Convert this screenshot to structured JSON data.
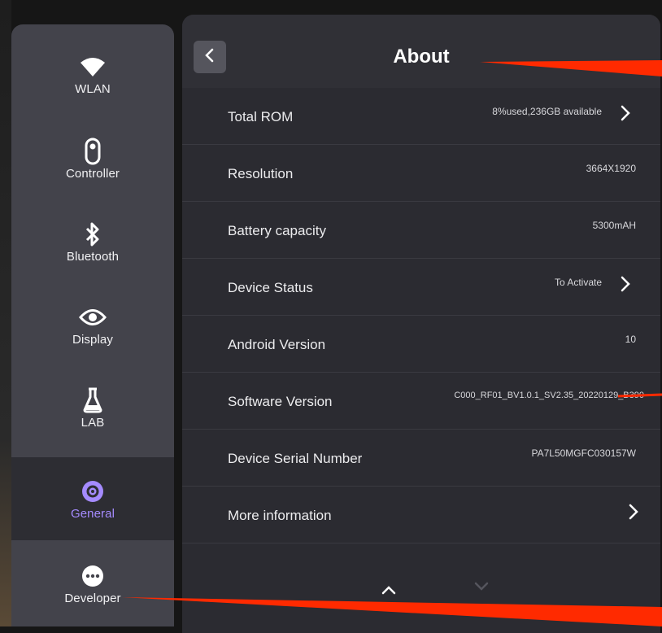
{
  "sidebar": {
    "items": [
      {
        "label": "WLAN",
        "icon": "wifi-icon",
        "active": false
      },
      {
        "label": "Controller",
        "icon": "controller-icon",
        "active": false
      },
      {
        "label": "Bluetooth",
        "icon": "bluetooth-icon",
        "active": false
      },
      {
        "label": "Display",
        "icon": "eye-icon",
        "active": false
      },
      {
        "label": "LAB",
        "icon": "flask-icon",
        "active": false
      },
      {
        "label": "General",
        "icon": "gear-icon",
        "active": true
      },
      {
        "label": "Developer",
        "icon": "more-dots-icon",
        "active": false
      }
    ]
  },
  "header": {
    "title": "About",
    "back_icon": "chevron-left-icon"
  },
  "rows": [
    {
      "label": "Total ROM",
      "value": "8%used,236GB available",
      "chevron": true
    },
    {
      "label": "Resolution",
      "value": "3664X1920",
      "chevron": false
    },
    {
      "label": "Battery capacity",
      "value": "5300mAH",
      "chevron": false
    },
    {
      "label": "Device Status",
      "value": "To Activate",
      "chevron": true
    },
    {
      "label": "Android Version",
      "value": "10",
      "chevron": false
    },
    {
      "label": "Software Version",
      "value": "C000_RF01_BV1.0.1_SV2.35_20220129_B390",
      "chevron": false
    },
    {
      "label": "Device Serial Number",
      "value": "PA7L50MGFC030157W",
      "chevron": false
    },
    {
      "label": "More information",
      "value": "",
      "chevron": true
    }
  ],
  "pager": {
    "up_icon": "chevron-up-icon",
    "down_icon": "chevron-down-icon"
  },
  "colors": {
    "sidebar_bg": "#43434b",
    "panel_bg": "#2b2b31",
    "active_accent": "#a58bff",
    "annotation": "#ff2a00"
  }
}
